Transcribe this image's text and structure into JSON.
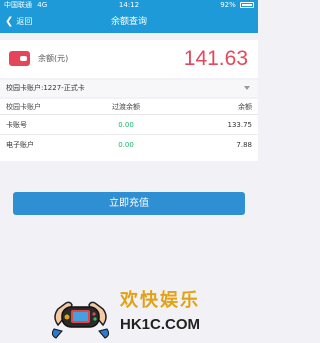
{
  "status_bar": {
    "carrier": "中国联通",
    "network": "4G",
    "time": "14:12",
    "battery": "92%"
  },
  "nav": {
    "back_label": "返回",
    "title": "余额查询"
  },
  "balance": {
    "label": "余额(元)",
    "value": "141.63"
  },
  "card_selector": {
    "label": "校园卡账户:1227-正式卡"
  },
  "table": {
    "headers": [
      "校园卡账户",
      "过渡余额",
      "余额"
    ],
    "rows": [
      {
        "account": "卡账号",
        "transit": "0.00",
        "balance": "133.75"
      },
      {
        "account": "电子账户",
        "transit": "0.00",
        "balance": "7.88"
      }
    ]
  },
  "recharge_button": {
    "label": "立即充值"
  },
  "watermark": {
    "title": "欢快娱乐",
    "url": "HK1C.COM"
  },
  "colors": {
    "header_bg": "#1f9ad8",
    "balance_red": "#e14a5c",
    "green": "#17b86a",
    "button_blue": "#2e8fd3"
  }
}
